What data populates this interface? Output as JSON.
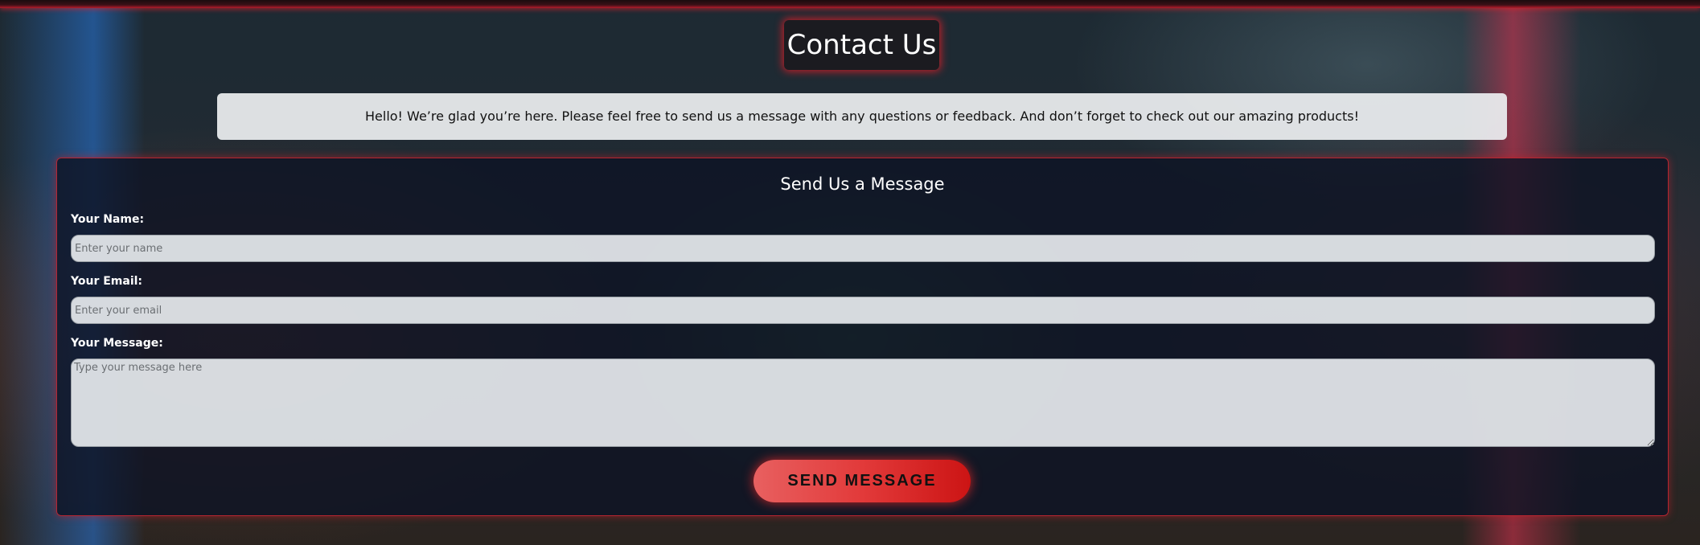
{
  "page": {
    "title": "Contact Us",
    "intro_text": "Hello! We’re glad you’re here. Please feel free to send us a message with any questions or feedback. And don’t forget to check out our amazing products!"
  },
  "form": {
    "heading": "Send Us a Message",
    "name": {
      "label": "Your Name:",
      "value": "",
      "placeholder": "Enter your name"
    },
    "email": {
      "label": "Your Email:",
      "value": "",
      "placeholder": "Enter your email"
    },
    "message": {
      "label": "Your Message:",
      "value": "",
      "placeholder": "Type your message here"
    },
    "submit_label": "SEND MESSAGE"
  },
  "colors": {
    "accent": "#e23a3a",
    "panel_border": "#d22832",
    "title_bg": "#1b1b20"
  }
}
